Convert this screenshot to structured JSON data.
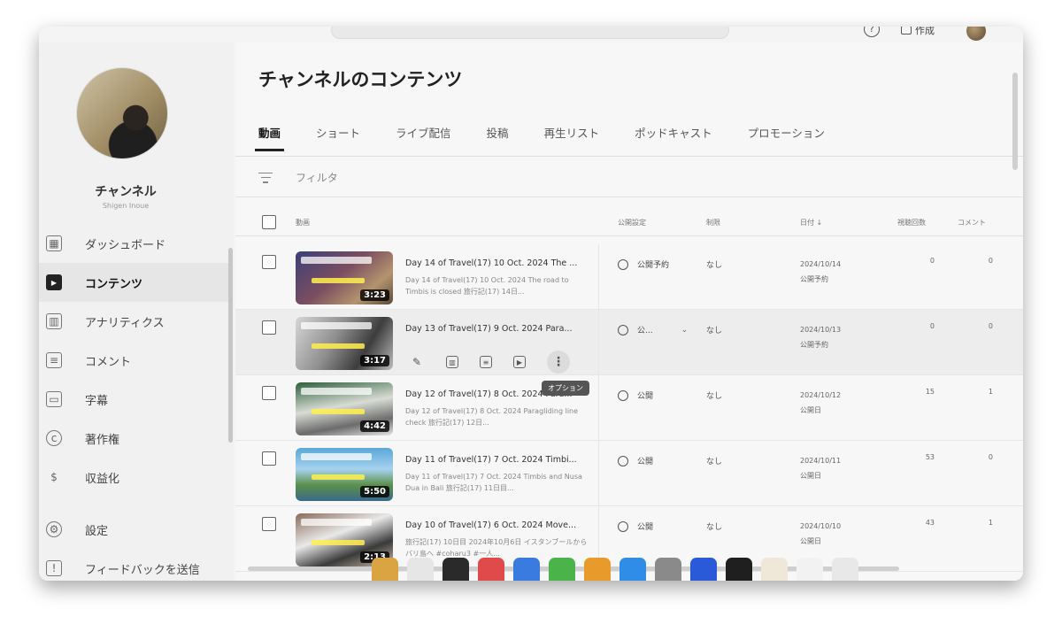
{
  "header": {
    "help_glyph": "?",
    "create_label": "作成"
  },
  "channel": {
    "name": "チャンネル",
    "handle": "Shigen Inoue"
  },
  "sidebar": {
    "items": [
      {
        "label": "ダッシュボード",
        "icon": "dashboard-icon"
      },
      {
        "label": "コンテンツ",
        "icon": "content-icon",
        "active": true
      },
      {
        "label": "アナリティクス",
        "icon": "analytics-icon"
      },
      {
        "label": "コメント",
        "icon": "comments-icon"
      },
      {
        "label": "字幕",
        "icon": "subtitles-icon"
      },
      {
        "label": "著作権",
        "icon": "copyright-icon"
      },
      {
        "label": "収益化",
        "icon": "monetization-icon"
      }
    ],
    "bottom": [
      {
        "label": "設定",
        "icon": "settings-icon"
      },
      {
        "label": "フィードバックを送信",
        "icon": "feedback-icon"
      }
    ]
  },
  "main": {
    "title": "チャンネルのコンテンツ",
    "tabs": [
      "動画",
      "ショート",
      "ライブ配信",
      "投稿",
      "再生リスト",
      "ポッドキャスト",
      "プロモーション"
    ],
    "filter_label": "フィルタ"
  },
  "table": {
    "headers": {
      "video": "動画",
      "visibility": "公開設定",
      "restrictions": "制限",
      "date": "日付 ↓",
      "views": "視聴回数",
      "comments": "コメント"
    },
    "rows": [
      {
        "title": "Day 14 of Travel(17) 10 Oct. 2024 The ...",
        "desc": "Day 14 of Travel(17) 10 Oct. 2024 The road to Timbis is closed 旅行記(17) 14日...",
        "duration": "3:23",
        "visibility": "公開予約",
        "restriction": "なし",
        "date": "2024/10/14",
        "date_status": "公開予約",
        "views": "0",
        "comments": "0"
      },
      {
        "title": "Day 13 of Travel(17) 9 Oct. 2024 Para...",
        "desc": "",
        "duration": "3:17",
        "visibility": "公...",
        "restriction": "なし",
        "date": "2024/10/13",
        "date_status": "公開予約",
        "views": "0",
        "comments": "0"
      },
      {
        "title": "Day 12 of Travel(17) 8 Oct. 2024 Para...",
        "desc": "Day 12 of Travel(17) 8 Oct. 2024 Paragliding line check 旅行記(17) 12日...",
        "duration": "4:42",
        "visibility": "公開",
        "restriction": "なし",
        "date": "2024/10/12",
        "date_status": "公開日",
        "views": "15",
        "comments": "1"
      },
      {
        "title": "Day 11 of Travel(17) 7 Oct. 2024 Timbi...",
        "desc": "Day 11 of Travel(17) 7 Oct. 2024 Timbis and Nusa Dua in Bali 旅行記(17) 11日目...",
        "duration": "5:50",
        "visibility": "公開",
        "restriction": "なし",
        "date": "2024/10/11",
        "date_status": "公開日",
        "views": "53",
        "comments": "0"
      },
      {
        "title": "Day 10 of Travel(17) 6 Oct. 2024 Move...",
        "desc": "旅行記(17) 10日目 2024年10月6日 イスタンブールからバリ島へ #coharu3 #一人...",
        "duration": "2:13",
        "visibility": "公開",
        "restriction": "なし",
        "date": "2024/10/10",
        "date_status": "公開日",
        "views": "43",
        "comments": "1"
      }
    ],
    "hover_actions": [
      "edit-icon",
      "analytics-icon",
      "comments-icon",
      "youtube-icon",
      "options-icon"
    ],
    "tooltip": "オプション"
  },
  "colors": {
    "accent": "#222222",
    "background": "#f7f7f7",
    "sidebar_bg": "#f1f1f1"
  }
}
